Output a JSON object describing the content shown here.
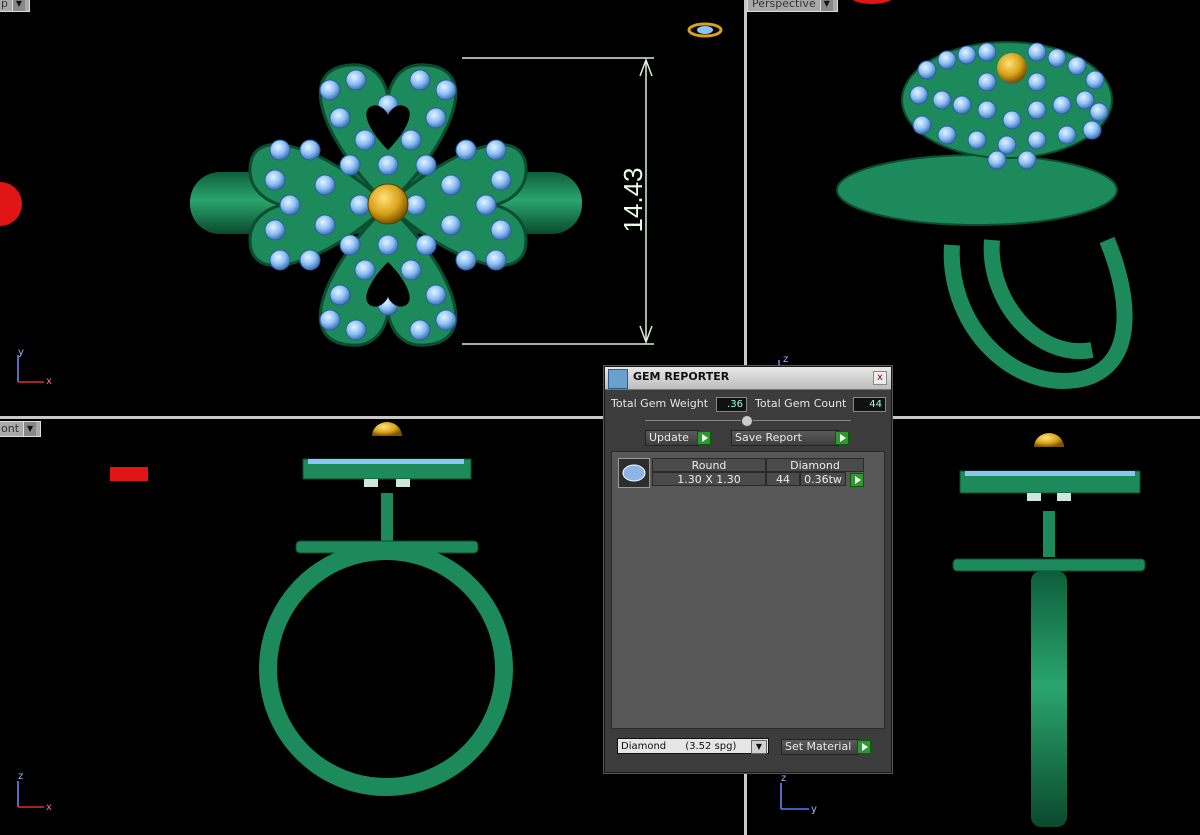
{
  "viewports": {
    "top_label": "p",
    "perspective_label": "Perspective",
    "front_label": "ont",
    "dimension_text": "14.43",
    "top_axes": {
      "v": "y",
      "h": "x"
    },
    "persp_axes": {
      "v": "z",
      "h": ""
    },
    "front_axes": {
      "v": "z",
      "h": "x"
    },
    "right_axes": {
      "v": "z",
      "h": "y"
    }
  },
  "gem_reporter": {
    "title": "GEM REPORTER",
    "close_glyph": "x",
    "total_weight_label": "Total Gem Weight",
    "total_weight_value": ".36",
    "total_count_label": "Total Gem Count",
    "total_count_value": "44",
    "update_label": "Update",
    "save_report_label": "Save Report",
    "row": {
      "shape": "Round",
      "size": "1.30 X 1.30",
      "material": "Diamond",
      "count": "44",
      "weight": "0.36tw"
    },
    "material_select_value": "Diamond      (3.52 spg)",
    "set_material_label": "Set Material"
  },
  "colors": {
    "metal_green": "#1c8a5a",
    "gem_blue": "#8fc2f5",
    "gold": "#d9a21a",
    "dimension_line": "#d8f0d8",
    "marker_red": "#e01515"
  }
}
